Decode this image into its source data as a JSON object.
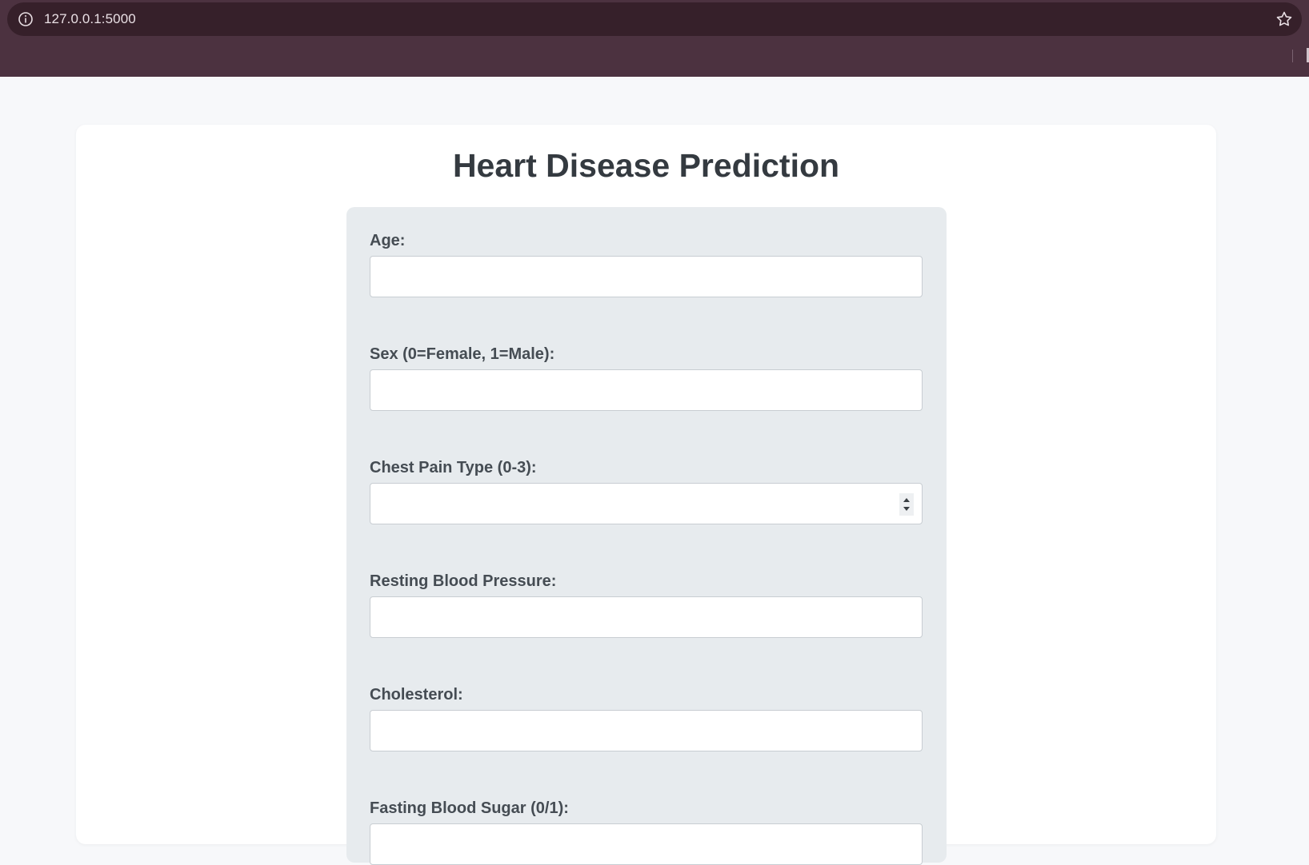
{
  "browser": {
    "url": "127.0.0.1:5000"
  },
  "page": {
    "title": "Heart Disease Prediction"
  },
  "form": {
    "fields": [
      {
        "label": "Age:",
        "value": ""
      },
      {
        "label": "Sex (0=Female, 1=Male):",
        "value": ""
      },
      {
        "label": "Chest Pain Type (0-3):",
        "value": ""
      },
      {
        "label": "Resting Blood Pressure:",
        "value": ""
      },
      {
        "label": "Cholesterol:",
        "value": ""
      },
      {
        "label": "Fasting Blood Sugar (0/1):",
        "value": ""
      }
    ]
  },
  "icons": {
    "site_info": "info-icon",
    "bookmark": "star-icon",
    "number_spinner": "spinner-icon"
  },
  "colors": {
    "browser_frame": "#4c3240",
    "url_bar": "#36202a",
    "page_bg": "#f7f8fa",
    "card_bg": "#ffffff",
    "form_panel": "#e7ebee",
    "title_text": "#343a40",
    "label_text": "#454c53"
  }
}
